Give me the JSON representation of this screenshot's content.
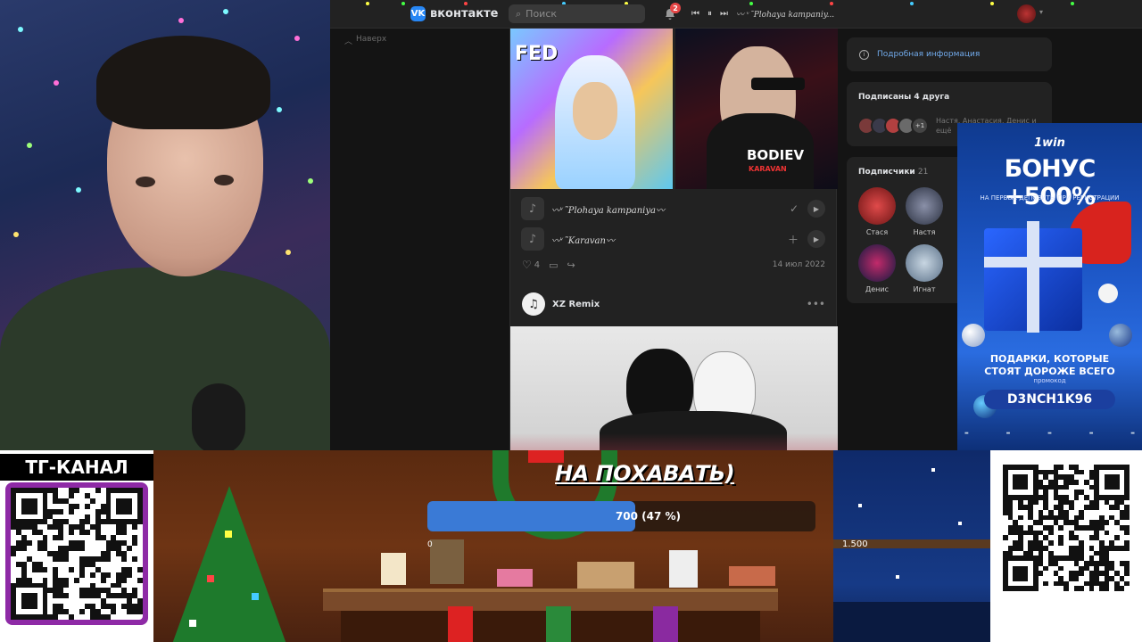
{
  "vk": {
    "logo_text": "вконтакте",
    "search_placeholder": "Поиск",
    "notifications_count": "2",
    "now_playing": "〰 ᵛ˜Plohaya kampaniy...",
    "back_up": "Наверх",
    "cover1_text": "FED",
    "cover2_text": "BODIEV",
    "cover2_sub": "KARAVAN",
    "tracks": [
      {
        "name": "〰ᵛ˜Plohaya kampaniya〰",
        "action_icon": "check-icon"
      },
      {
        "name": "〰ᵛ˜Karavan〰",
        "action_icon": "plus-icon"
      }
    ],
    "likes_count": "4",
    "post_date": "14 июл 2022",
    "post2_author": "XZ Remix",
    "info_link": "Подробная информация",
    "friends_title": "Подписаны 4 друга",
    "friends_more": "+1",
    "friends_names": "Настя, Анастасия, Денис и ещё",
    "subscribers_title": "Подписчики",
    "subscribers_count": "21",
    "subscribers": [
      {
        "name": "Стася",
        "color": "#b2272a"
      },
      {
        "name": "Настя",
        "color": "#55617a"
      },
      {
        "name": "Денис",
        "color": "#1f2a5a"
      },
      {
        "name": "Игнат",
        "color": "#8aa0b4"
      }
    ]
  },
  "ad": {
    "logo": "1win",
    "bonus": "БОНУС +500%",
    "subtitle": "НА ПЕРВЫЕ ДЕПОЗИТЫ ПРИ РЕГИСТРАЦИИ",
    "gifts_line1": "ПОДАРКИ, КОТОРЫЕ",
    "gifts_line2": "СТОЯТ ДОРОЖЕ ВСЕГО",
    "promo_label": "промокод",
    "promo_code": "D3NCH1K96"
  },
  "overlay": {
    "tg_title": "ТГ-КАНАЛ",
    "headline": "НА ПОХАВАТЬ)",
    "progress_text": "700 (47 %)",
    "progress_fraction": 0.47,
    "goal_min": "0",
    "goal_max": "1.500"
  },
  "colors": {
    "vk_accent": "#2787f5",
    "link": "#71aaeb",
    "progress": "#3a7ad6",
    "tg_qr_bg": "#8e2aa6"
  }
}
